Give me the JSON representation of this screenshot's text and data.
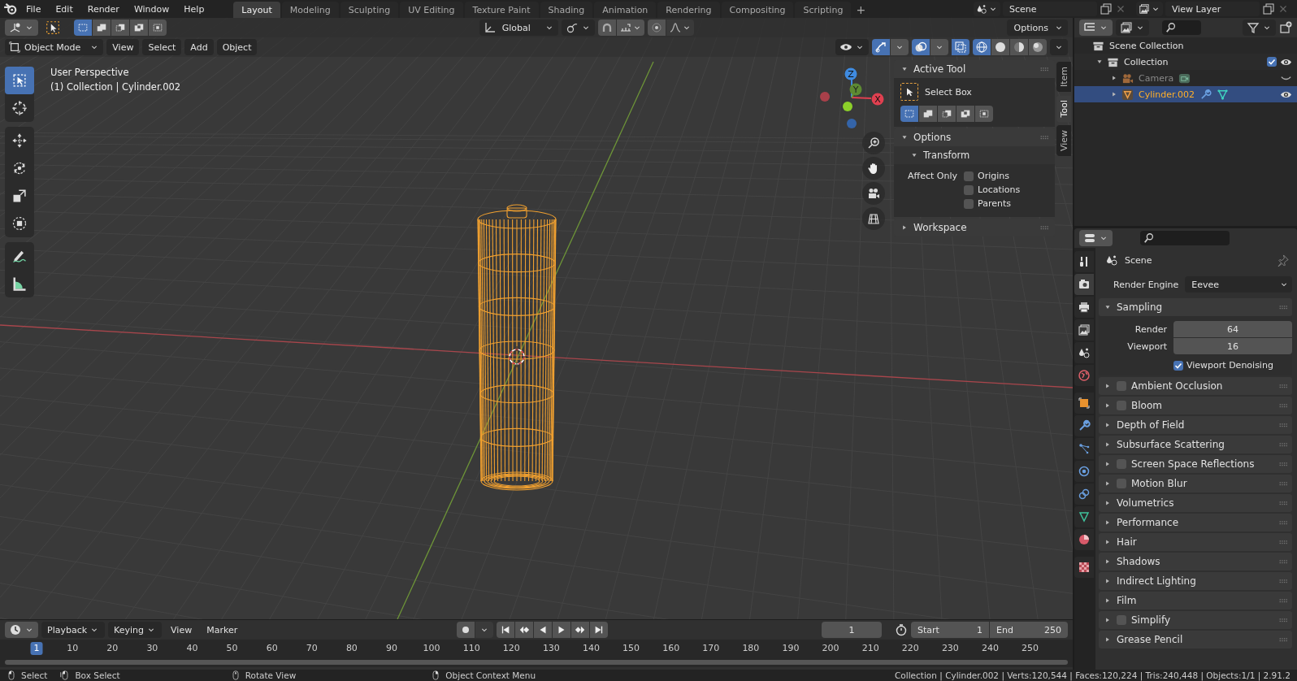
{
  "menu": [
    "File",
    "Edit",
    "Render",
    "Window",
    "Help"
  ],
  "workspaces": [
    {
      "label": "Layout",
      "selected": true
    },
    {
      "label": "Modeling",
      "selected": false
    },
    {
      "label": "Sculpting",
      "selected": false
    },
    {
      "label": "UV Editing",
      "selected": false
    },
    {
      "label": "Texture Paint",
      "selected": false
    },
    {
      "label": "Shading",
      "selected": false
    },
    {
      "label": "Animation",
      "selected": false
    },
    {
      "label": "Rendering",
      "selected": false
    },
    {
      "label": "Compositing",
      "selected": false
    },
    {
      "label": "Scripting",
      "selected": false
    }
  ],
  "add_workspace": "+",
  "scene": "Scene",
  "view_layer": "View Layer",
  "tool_header": {
    "select_modes": [
      {
        "selected": true
      },
      {
        "selected": false
      },
      {
        "selected": false
      },
      {
        "selected": false
      },
      {
        "selected": false
      }
    ],
    "orientation": "Global",
    "options": "Options"
  },
  "viewport_header": {
    "mode": "Object Mode",
    "menus": [
      "View",
      "Select",
      "Add",
      "Object"
    ],
    "shading": [
      {
        "kind": "wireframe",
        "selected": true
      },
      {
        "kind": "solid",
        "selected": false
      },
      {
        "kind": "material",
        "selected": false
      },
      {
        "kind": "rendered",
        "selected": false
      }
    ]
  },
  "viewport": {
    "perspective": "User Perspective",
    "context": "(1) Collection | Cylinder.002",
    "gizmo_axes": [
      "X",
      "Y",
      "Z"
    ]
  },
  "toolbar": [
    [
      {
        "kind": "select_box",
        "selected": true
      },
      {
        "kind": "cursor",
        "selected": false
      }
    ],
    [
      {
        "kind": "move",
        "selected": false
      },
      {
        "kind": "rotate",
        "selected": false
      },
      {
        "kind": "scale",
        "selected": false
      },
      {
        "kind": "transform",
        "selected": false
      }
    ],
    [
      {
        "kind": "annotate",
        "selected": false
      },
      {
        "kind": "measure",
        "selected": false
      }
    ]
  ],
  "sidebar": {
    "tabs": [
      {
        "label": "Item",
        "selected": false
      },
      {
        "label": "Tool",
        "selected": true
      },
      {
        "label": "View",
        "selected": false
      }
    ],
    "active_tool": {
      "title": "Active Tool",
      "tool": "Select Box",
      "modes": [
        {
          "selected": true
        },
        {
          "selected": false
        },
        {
          "selected": false
        },
        {
          "selected": false
        },
        {
          "selected": false
        }
      ]
    },
    "options": {
      "title": "Options",
      "transform": "Transform",
      "affect_only": "Affect Only",
      "checks": [
        {
          "label": "Origins",
          "checked": false
        },
        {
          "label": "Locations",
          "checked": false
        },
        {
          "label": "Parents",
          "checked": false
        }
      ]
    },
    "workspace": "Workspace"
  },
  "outliner": {
    "items": [
      {
        "label": "Scene Collection",
        "kind": "scene_collection",
        "selected": false,
        "children": [
          {
            "label": "Collection",
            "kind": "collection",
            "selected": false,
            "expanded": true,
            "checked": true,
            "visible": true,
            "children": [
              {
                "label": "Camera",
                "kind": "camera",
                "selected": false,
                "expanded": false,
                "disabled": true,
                "visible": false,
                "extras": [
                  {
                    "kind": "camera_data"
                  }
                ]
              },
              {
                "label": "Cylinder.002",
                "kind": "mesh",
                "selected": true,
                "expanded": false,
                "disabled": false,
                "visible": true,
                "extras": [
                  {
                    "kind": "modifier"
                  },
                  {
                    "kind": "mesh_data"
                  }
                ]
              }
            ]
          }
        ]
      }
    ]
  },
  "properties": {
    "tab_groups": [
      [
        {
          "kind": "tool",
          "selected": false
        },
        {
          "kind": "render",
          "selected": true
        },
        {
          "kind": "output",
          "selected": false
        },
        {
          "kind": "view_layer",
          "selected": false
        },
        {
          "kind": "scene",
          "selected": false
        },
        {
          "kind": "world",
          "selected": false
        }
      ],
      [
        {
          "kind": "object",
          "selected": false
        },
        {
          "kind": "modifiers",
          "selected": false
        },
        {
          "kind": "particles",
          "selected": false
        },
        {
          "kind": "physics",
          "selected": false
        },
        {
          "kind": "constraints",
          "selected": false
        },
        {
          "kind": "data",
          "selected": false
        },
        {
          "kind": "material",
          "selected": false
        }
      ],
      [
        {
          "kind": "texture",
          "selected": false
        }
      ]
    ],
    "context": "Scene",
    "engine_label": "Render Engine",
    "engine": "Eevee",
    "sampling": {
      "title": "Sampling",
      "expanded": true,
      "fields": [
        {
          "label": "Render",
          "value": "64"
        },
        {
          "label": "Viewport",
          "value": "16"
        }
      ],
      "denoise": {
        "label": "Viewport Denoising",
        "checked": true
      }
    },
    "panels": [
      {
        "label": "Ambient Occlusion",
        "kind": "toggle",
        "checked": false
      },
      {
        "label": "Bloom",
        "kind": "toggle",
        "checked": false
      },
      {
        "label": "Depth of Field",
        "kind": "plain"
      },
      {
        "label": "Subsurface Scattering",
        "kind": "plain"
      },
      {
        "label": "Screen Space Reflections",
        "kind": "toggle",
        "checked": false
      },
      {
        "label": "Motion Blur",
        "kind": "toggle",
        "checked": false
      },
      {
        "label": "Volumetrics",
        "kind": "plain"
      },
      {
        "label": "Performance",
        "kind": "plain"
      },
      {
        "label": "Hair",
        "kind": "plain"
      },
      {
        "label": "Shadows",
        "kind": "plain"
      },
      {
        "label": "Indirect Lighting",
        "kind": "plain"
      },
      {
        "label": "Film",
        "kind": "plain"
      },
      {
        "label": "Simplify",
        "kind": "toggle",
        "checked": false
      },
      {
        "label": "Grease Pencil",
        "kind": "plain"
      }
    ]
  },
  "timeline": {
    "menus": [
      {
        "label": "Playback",
        "kind": "dropdown"
      },
      {
        "label": "Keying",
        "kind": "dropdown"
      },
      {
        "label": "View",
        "kind": "menu"
      },
      {
        "label": "Marker",
        "kind": "menu"
      }
    ],
    "current_frame": "1",
    "start_label": "Start",
    "start": "1",
    "end_label": "End",
    "end": "250",
    "ticks": [
      {
        "label": "1",
        "selected": true
      },
      {
        "label": "10",
        "selected": false
      },
      {
        "label": "20",
        "selected": false
      },
      {
        "label": "30",
        "selected": false
      },
      {
        "label": "40",
        "selected": false
      },
      {
        "label": "50",
        "selected": false
      },
      {
        "label": "60",
        "selected": false
      },
      {
        "label": "70",
        "selected": false
      },
      {
        "label": "80",
        "selected": false
      },
      {
        "label": "90",
        "selected": false
      },
      {
        "label": "100",
        "selected": false
      },
      {
        "label": "110",
        "selected": false
      },
      {
        "label": "120",
        "selected": false
      },
      {
        "label": "130",
        "selected": false
      },
      {
        "label": "140",
        "selected": false
      },
      {
        "label": "150",
        "selected": false
      },
      {
        "label": "160",
        "selected": false
      },
      {
        "label": "170",
        "selected": false
      },
      {
        "label": "180",
        "selected": false
      },
      {
        "label": "190",
        "selected": false
      },
      {
        "label": "200",
        "selected": false
      },
      {
        "label": "210",
        "selected": false
      },
      {
        "label": "220",
        "selected": false
      },
      {
        "label": "230",
        "selected": false
      },
      {
        "label": "240",
        "selected": false
      },
      {
        "label": "250",
        "selected": false
      }
    ]
  },
  "status_bar": {
    "hints": [
      {
        "label": "Select",
        "kind": "left"
      },
      {
        "label": "Box Select",
        "kind": "drag"
      },
      {
        "label": "Rotate View",
        "kind": "middle"
      },
      {
        "label": "Object Context Menu",
        "kind": "right"
      }
    ],
    "stats": "Collection | Cylinder.002 | Verts:120,544 | Faces:120,224 | Tris:240,448 | Objects:1/1 | 2.91.2"
  }
}
